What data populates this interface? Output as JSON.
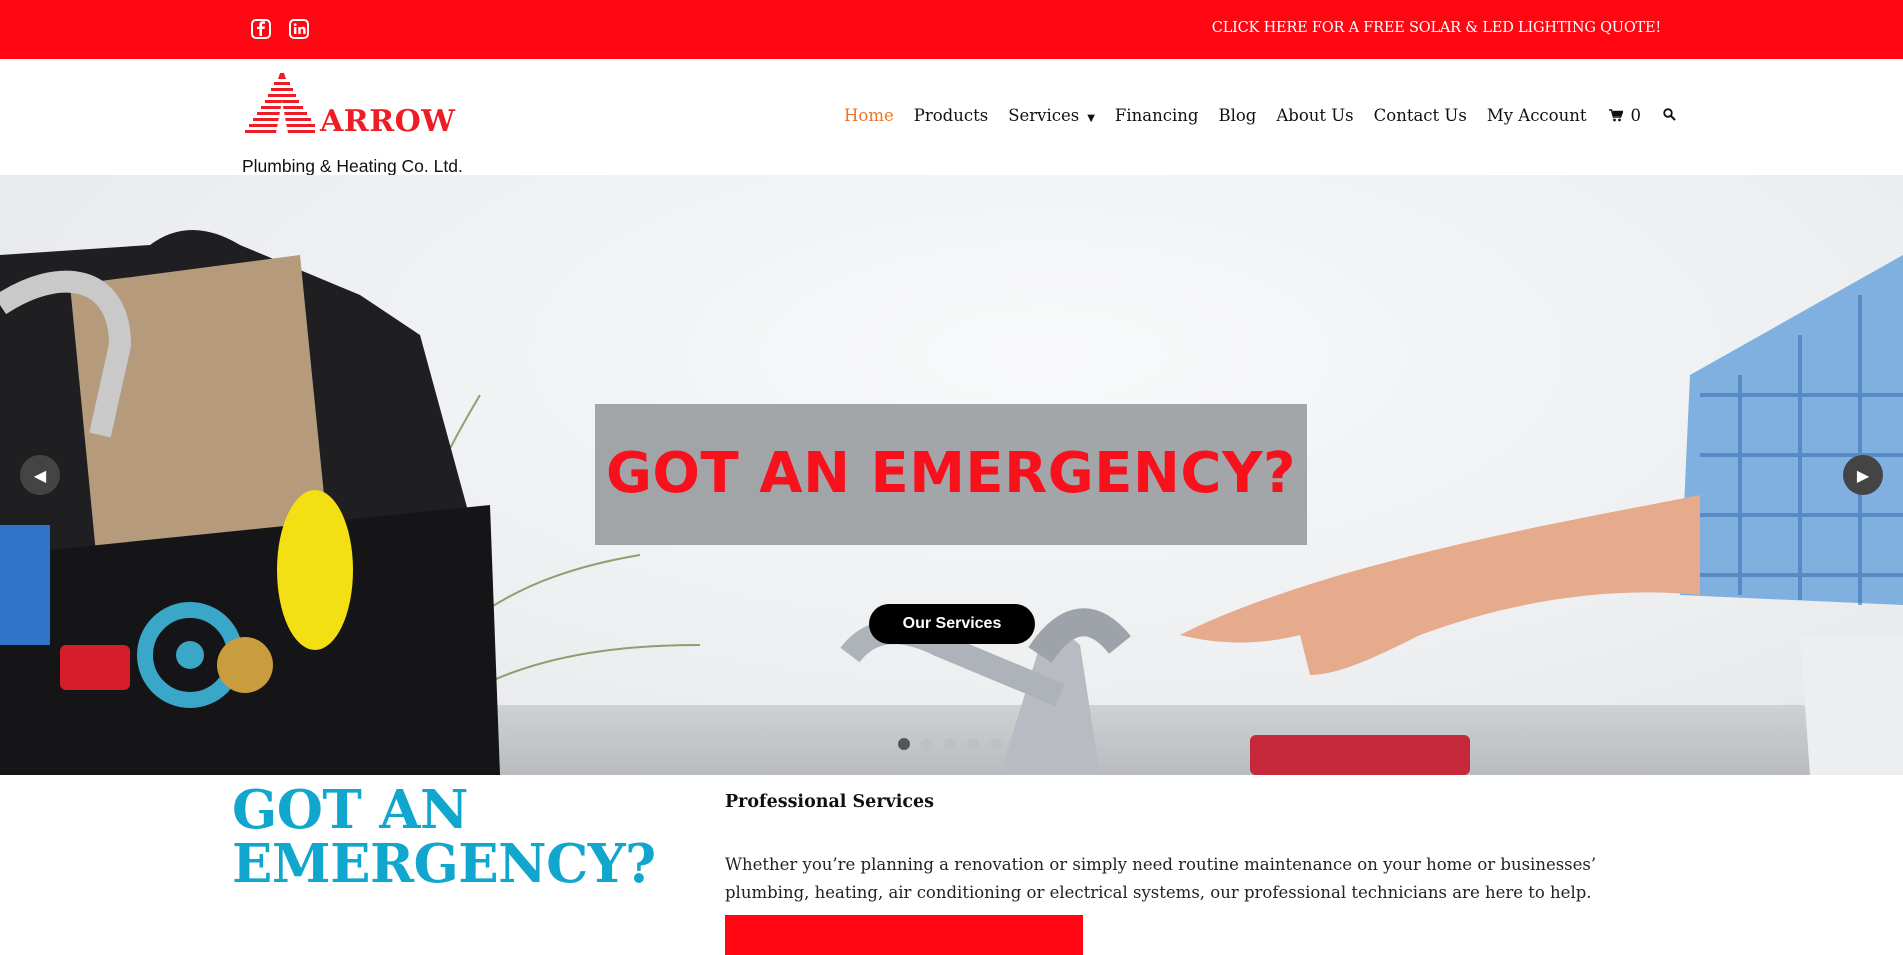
{
  "topbar": {
    "social": [
      {
        "icon": "facebook-icon"
      },
      {
        "icon": "linkedin-icon"
      }
    ],
    "quote_link": "CLICK HERE FOR A FREE SOLAR & LED LIGHTING QUOTE!"
  },
  "logo": {
    "brand": "ARROW",
    "sub": "Plumbing & Heating Co. Ltd."
  },
  "nav": {
    "items": [
      {
        "label": "Home"
      },
      {
        "label": "Products"
      },
      {
        "label": "Services"
      },
      {
        "label": "Financing"
      },
      {
        "label": "Blog"
      },
      {
        "label": "About Us"
      },
      {
        "label": "Contact Us"
      },
      {
        "label": "My Account"
      }
    ],
    "cart_count": "0"
  },
  "hero": {
    "caption": "GOT AN EMERGENCY?",
    "button": "Our Services",
    "slides": 5,
    "active_slide": 1
  },
  "content": {
    "title_line1": "GOT AN",
    "title_line2": "EMERGENCY?",
    "heading": "Professional Services",
    "body": "Whether you’re planning a renovation or simply need routine maintenance on your home or businesses’ plumbing, heating, air conditioning or electrical systems, our professional technicians are here to help."
  },
  "colors": {
    "topbar": "#ff0612",
    "nav_active": "#f07422",
    "caption": "#f8101d",
    "title": "#11a6cd"
  }
}
